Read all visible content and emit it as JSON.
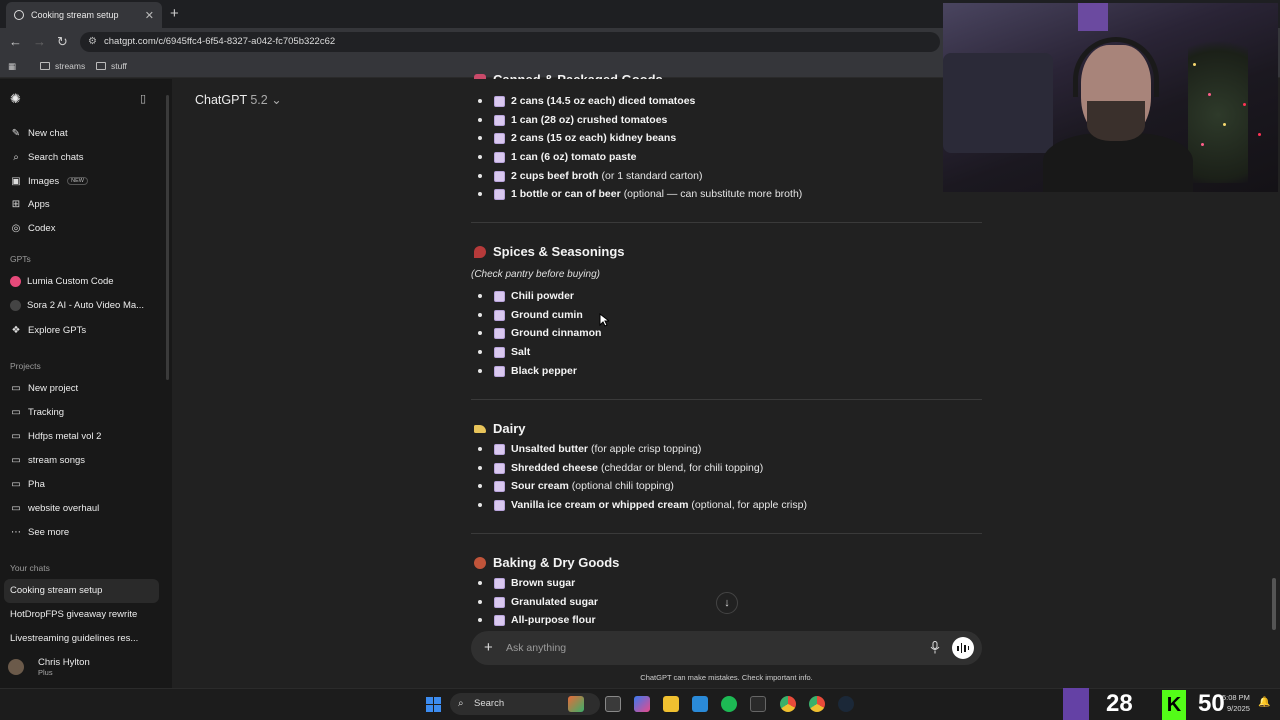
{
  "browser": {
    "tab_title": "Cooking stream setup",
    "url": "chatgpt.com/c/6945ffc4-6f54-8327-a042-fc705b322c62",
    "bookmarks": [
      "streams",
      "stuff"
    ]
  },
  "sidebar": {
    "nav": [
      {
        "label": "New chat",
        "icon": "new-chat-icon"
      },
      {
        "label": "Search chats",
        "icon": "search-icon"
      },
      {
        "label": "Images",
        "icon": "images-icon",
        "badge": "NEW"
      },
      {
        "label": "Apps",
        "icon": "apps-icon"
      },
      {
        "label": "Codex",
        "icon": "codex-icon"
      }
    ],
    "gpts_heading": "GPTs",
    "gpts": [
      {
        "label": "Lumia Custom Code"
      },
      {
        "label": "Sora 2 AI - Auto Video Ma..."
      },
      {
        "label": "Explore GPTs"
      }
    ],
    "projects_heading": "Projects",
    "projects": [
      {
        "label": "New project"
      },
      {
        "label": "Tracking"
      },
      {
        "label": "Hdfps metal vol 2"
      },
      {
        "label": "stream songs"
      },
      {
        "label": "Pha"
      },
      {
        "label": "website overhaul"
      },
      {
        "label": "See more"
      }
    ],
    "chats_heading": "Your chats",
    "chats": [
      {
        "label": "Cooking stream setup"
      },
      {
        "label": "HotDropFPS giveaway rewrite"
      },
      {
        "label": "Livestreaming guidelines res..."
      }
    ],
    "user": {
      "name": "Chris Hylton",
      "plan": "Plus"
    }
  },
  "header": {
    "model_name": "ChatGPT",
    "model_version": "5.2"
  },
  "content": {
    "section_canned": {
      "heading": "Canned & Packaged Goods",
      "items": [
        {
          "bold": "2 cans (14.5 oz each) diced tomatoes",
          "rest": ""
        },
        {
          "bold": "1 can (28 oz) crushed tomatoes",
          "rest": ""
        },
        {
          "bold": "2 cans (15 oz each) kidney beans",
          "rest": ""
        },
        {
          "bold": "1 can (6 oz) tomato paste",
          "rest": ""
        },
        {
          "bold": "2 cups beef broth",
          "rest": "(or 1 standard carton)"
        },
        {
          "bold": "1 bottle or can of beer",
          "rest": "(optional — can substitute more broth)"
        }
      ]
    },
    "section_spices": {
      "heading": "Spices & Seasonings",
      "note": "(Check pantry before buying)",
      "items": [
        {
          "bold": "Chili powder"
        },
        {
          "bold": "Ground cumin"
        },
        {
          "bold": "Ground cinnamon"
        },
        {
          "bold": "Salt"
        },
        {
          "bold": "Black pepper"
        }
      ]
    },
    "section_dairy": {
      "heading": "Dairy",
      "items": [
        {
          "bold": "Unsalted butter",
          "rest": "(for apple crisp topping)"
        },
        {
          "bold": "Shredded cheese",
          "rest": "(cheddar or blend, for chili topping)"
        },
        {
          "bold": "Sour cream",
          "rest": "(optional chili topping)"
        },
        {
          "bold": "Vanilla ice cream or whipped cream",
          "rest": "(optional, for apple crisp)"
        }
      ]
    },
    "section_baking": {
      "heading": "Baking & Dry Goods",
      "items": [
        {
          "bold": "Brown sugar"
        },
        {
          "bold": "Granulated sugar"
        },
        {
          "bold": "All-purpose flour"
        }
      ]
    }
  },
  "composer": {
    "placeholder": "Ask anything"
  },
  "disclaimer": "ChatGPT can make mistakes. Check important info.",
  "taskbar": {
    "search_label": "Search",
    "twitch_count": "28",
    "kick_logo": "K",
    "kick_count": "50",
    "time": "5:08 PM",
    "date": "9/2025"
  },
  "colors": {
    "accent_checkbox": "#d9c8ef",
    "twitch": "#6441a5",
    "kick": "#53fc18"
  }
}
